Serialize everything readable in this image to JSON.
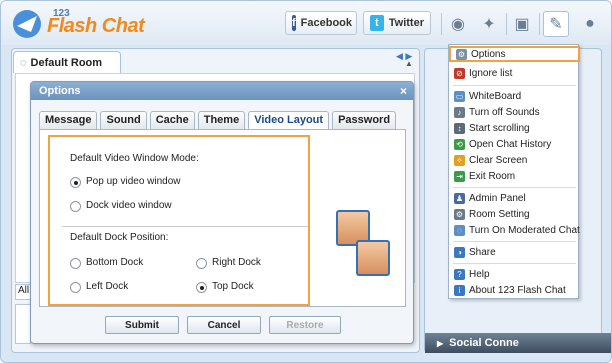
{
  "header": {
    "logo_small": "123",
    "logo_text": "Flash Chat",
    "facebook_label": "Facebook",
    "twitter_label": "Twitter"
  },
  "room": {
    "tab_label": "Default Room",
    "all_field": "All"
  },
  "dialog": {
    "title": "Options",
    "close": "×",
    "tabs": [
      "Message",
      "Sound",
      "Cache",
      "Theme",
      "Video Layout",
      "Password"
    ],
    "active_tab": "Video Layout",
    "mode_heading": "Default Video Window Mode:",
    "mode_options": [
      "Pop up video window",
      "Dock video window"
    ],
    "mode_selected": "Pop up video window",
    "dock_heading": "Default Dock Position:",
    "dock_options": [
      "Bottom Dock",
      "Right Dock",
      "Left Dock",
      "Top Dock"
    ],
    "dock_selected": "Top Dock",
    "buttons": {
      "submit": "Submit",
      "cancel": "Cancel",
      "restore": "Restore"
    }
  },
  "menu": {
    "items": [
      {
        "label": "Options",
        "icon": "options-icon"
      },
      {
        "label": "Ignore list",
        "icon": "ignore-icon"
      },
      {
        "label": "WhiteBoard",
        "icon": "whiteboard-icon"
      },
      {
        "label": "Turn off Sounds",
        "icon": "sound-icon"
      },
      {
        "label": "Start scrolling",
        "icon": "scroll-icon"
      },
      {
        "label": "Open Chat History",
        "icon": "history-icon"
      },
      {
        "label": "Clear Screen",
        "icon": "clear-icon"
      },
      {
        "label": "Exit Room",
        "icon": "exit-icon"
      },
      {
        "label": "Admin Panel",
        "icon": "admin-icon"
      },
      {
        "label": "Room Setting",
        "icon": "room-setting-icon"
      },
      {
        "label": "Turn On Moderated Chat",
        "icon": "moderated-icon"
      },
      {
        "label": "Share",
        "icon": "share-icon"
      },
      {
        "label": "Help",
        "icon": "help-icon"
      },
      {
        "label": "About 123 Flash Chat",
        "icon": "about-icon"
      }
    ]
  },
  "social_bar": {
    "label": "Social Conne"
  },
  "colors": {
    "accent": "#f0a340",
    "brand_orange": "#f08a1c",
    "title_blue": "#6b93bd"
  }
}
